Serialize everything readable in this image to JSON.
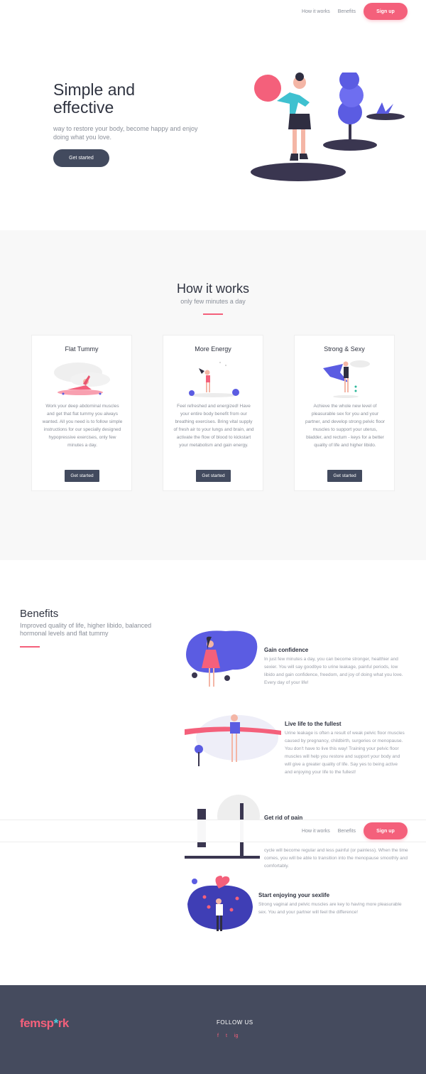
{
  "nav": {
    "how_it_works": "How it works",
    "benefits": "Benefits",
    "signup": "Sign up"
  },
  "hero": {
    "title": "Simple and effective",
    "subtitle": "way to restore your body, become happy and enjoy doing what you love.",
    "cta": "Get started"
  },
  "how": {
    "title": "How it works",
    "subtitle": "only few minutes a day",
    "cards": [
      {
        "title": "Flat Tummy",
        "text": "Work your deep abdominal muscles and get that flat tummy you always wanted. All you need is to follow simple instructions for our specially designed hypopressive exercises, only few minutes a day.",
        "button": "Get started"
      },
      {
        "title": "More Energy",
        "text": "Feel refreshed and energized! Have your entire body benefit from our breathing exercises. Bring vital supply of fresh air to your lungs and brain, and activate the flow of blood to kickstart your metabolism and gain energy.",
        "button": "Get started"
      },
      {
        "title": "Strong & Sexy",
        "text": "Achieve the whole new level of pleasurable sex for you and your partner, and develop strong pelvic floor muscles to support your uterus, bladder, and rectum - keys for a better quality of life and higher libido.",
        "button": "Get started"
      }
    ]
  },
  "benefits": {
    "title": "Benefits",
    "intro": "Improved quality of life, higher libido, balanced hormonal levels and flat tummy",
    "items": [
      {
        "title": "Gain confidence",
        "text": "In just few minutes a day, you can become stronger, healthier and sexier. You will say goodbye to urine leakage, painful periods, low libido and gain confidence, freedom, and joy of doing what you love. Every day of your life!"
      },
      {
        "title": "Live life to the fullest",
        "text": "Urine leakage is often a result of weak pelvic floor muscles caused by pregnancy, childbirth, surgeries or menopause. You don't have to live this way! Training your pelvic floor muscles will help you restore and support your body and will give a greater quality of life. Say yes to being active and enjoying your life to the fullest!"
      },
      {
        "title": "Get rid of pain",
        "text": "cycle will become regular and less painful (or painless). When the time comes, you will be able to transition into the menopause smoothly and comfortably."
      },
      {
        "title": "Start enjoying your sexlife",
        "text": "Strong vaginal and pelvic muscles are key to having more pleasurable sex. You and your partner will feel the difference!"
      }
    ]
  },
  "footer": {
    "logo_a": "femsp",
    "logo_star": "*",
    "logo_b": "rk",
    "follow": "FOLLOW US",
    "social": [
      "f",
      "t",
      "ig"
    ]
  },
  "colors": {
    "accent": "#f4607b",
    "dark": "#424a5e",
    "footer": "#454b5e",
    "purple": "#5b5ce2",
    "teal": "#4fd0e0"
  }
}
